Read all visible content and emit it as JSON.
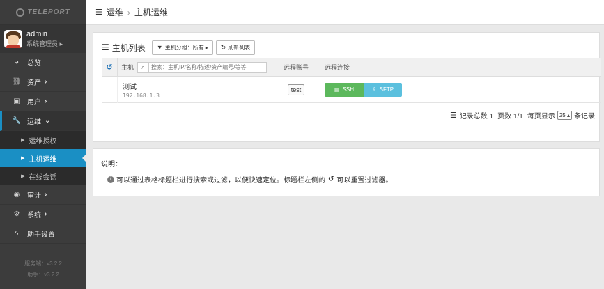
{
  "app": {
    "logo": "TELEPORT"
  },
  "user": {
    "name": "admin",
    "role": "系统管理员"
  },
  "sidebar": {
    "items": [
      {
        "label": "总览"
      },
      {
        "label": "资产"
      },
      {
        "label": "用户"
      },
      {
        "label": "运维"
      },
      {
        "label": "审计"
      },
      {
        "label": "系统"
      },
      {
        "label": "助手设置"
      }
    ],
    "sub_items": [
      {
        "label": "运维授权"
      },
      {
        "label": "主机运维"
      },
      {
        "label": "在线会话"
      }
    ],
    "version_server": "服务端：v3.2.2",
    "version_assist": "助手：v3.2.2"
  },
  "breadcrumb": {
    "section": "运维",
    "page": "主机运维"
  },
  "panel": {
    "title": "主机列表",
    "group_filter_label": "主机分组：所有",
    "refresh_label": "刷新列表"
  },
  "table": {
    "col_host": "主机",
    "search_placeholder": "搜索：主机IP/名称/描述/资产编号/等等",
    "col_account": "远程账号",
    "col_connect": "远程连接",
    "rows": [
      {
        "name": "测试",
        "ip": "192.168.1.3",
        "account": "test",
        "ssh": "SSH",
        "sftp": "SFTP"
      }
    ]
  },
  "pager": {
    "total_label": "记录总数 1",
    "pages_label": "页数 1/1",
    "per_page_label": "每页显示",
    "per_page_value": "25",
    "suffix": "条记录"
  },
  "notes": {
    "title": "说明：",
    "line_part1": "可以通过表格标题栏进行搜索或过滤，以便快速定位。标题栏左侧的",
    "line_part2": "可以重置过滤器。"
  }
}
